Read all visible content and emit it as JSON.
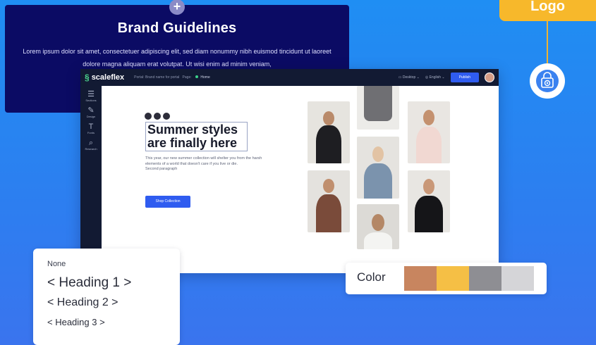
{
  "brand": {
    "title": "Brand Guidelines",
    "text": "Lorem ipsum dolor sit amet, consectetuer adipiscing elit, sed diam nonummy nibh euismod tincidunt ut laoreet dolore magna aliquam erat volutpat. Ut wisi enim ad minim veniam,",
    "plus": "+"
  },
  "logo": {
    "label": "Logo",
    "icon": "shopping-bag-icon"
  },
  "editor": {
    "app_name": "scaleflex",
    "breadcrumb": "Portal: Brand name for portal",
    "page_label": "Page:",
    "page_name": "Home",
    "device": "Desktop",
    "language": "English",
    "publish": "Publish",
    "sidebar": [
      {
        "label": "Sections",
        "icon": "menu-icon"
      },
      {
        "label": "Design",
        "icon": "brush-icon"
      },
      {
        "label": "Fonts",
        "icon": "text-icon"
      },
      {
        "label": "Research",
        "icon": "search-icon"
      }
    ],
    "headline_line1": "Summer styles",
    "headline_line2": "are finally here",
    "paragraph": "This year, our new summer collection will shelter you from the harsh elements of a world that doesn't care if you live or die.",
    "paragraph2": "Second paragraph",
    "shop_button": "Shop Collection"
  },
  "headings": {
    "none": "None",
    "h1": "< Heading 1 >",
    "h2": "< Heading 2 >",
    "h3": "< Heading 3 >"
  },
  "colors": {
    "label": "Color",
    "swatches": [
      "#c8855f",
      "#f5bf45",
      "#8e8e93",
      "#d5d5d8"
    ]
  }
}
